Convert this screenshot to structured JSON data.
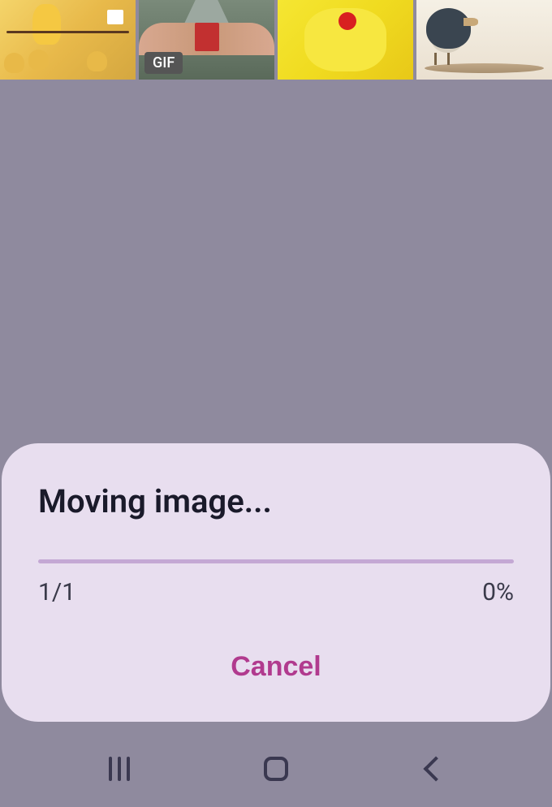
{
  "thumbnails": {
    "gif_badge": "GIF"
  },
  "dialog": {
    "title": "Moving image...",
    "progress_count": "1/1",
    "progress_percent": "0%",
    "cancel_label": "Cancel"
  },
  "navigation": {
    "recent_label": "recent-apps",
    "home_label": "home",
    "back_label": "back"
  }
}
